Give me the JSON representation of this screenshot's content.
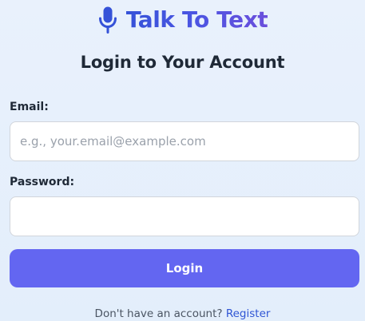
{
  "brand": {
    "title": "Talk To Text",
    "icon": "microphone-icon",
    "color": "#3552d8"
  },
  "form": {
    "heading": "Login to Your Account",
    "email_label": "Email:",
    "email_placeholder": "e.g., your.email@example.com",
    "email_value": "",
    "password_label": "Password:",
    "password_placeholder": "",
    "password_value": "",
    "submit_label": "Login",
    "submit_color": "#6366f1"
  },
  "footer": {
    "prompt": "Don't have an account?",
    "register_label": "Register",
    "link_color": "#2f55d4"
  }
}
